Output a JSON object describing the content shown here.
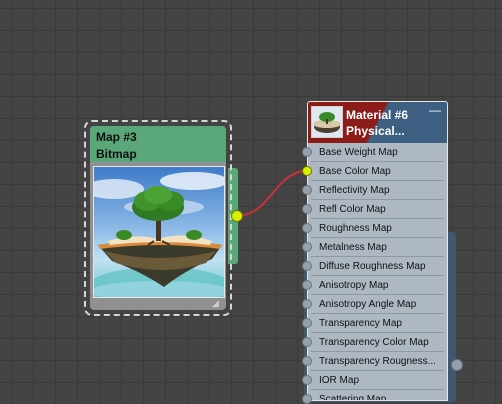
{
  "bitmap_node": {
    "title": "Map #3",
    "type": "Bitmap",
    "resize_glyph": "◢",
    "colors": {
      "header": "#5aa87a",
      "output_socket": "#d8f000"
    }
  },
  "material_node": {
    "title": "Material #6",
    "type": "Physical...",
    "collapse_glyph": "—",
    "colors": {
      "header_left": "#8b1c18",
      "header_right": "#3d5f82",
      "active_socket": "#d8f000"
    },
    "slots": [
      {
        "label": "Base Weight Map",
        "connected": false
      },
      {
        "label": "Base Color Map",
        "connected": true
      },
      {
        "label": "Reflectivity Map",
        "connected": false
      },
      {
        "label": "Refl Color Map",
        "connected": false
      },
      {
        "label": "Roughness Map",
        "connected": false
      },
      {
        "label": "Metalness Map",
        "connected": false
      },
      {
        "label": "Diffuse Roughness Map",
        "connected": false
      },
      {
        "label": "Anisotropy Map",
        "connected": false
      },
      {
        "label": "Anisotropy Angle Map",
        "connected": false
      },
      {
        "label": "Transparency Map",
        "connected": false
      },
      {
        "label": "Transparency Color Map",
        "connected": false
      },
      {
        "label": "Transparency Rougness...",
        "connected": false
      },
      {
        "label": "IOR Map",
        "connected": false
      },
      {
        "label": "Scattering Map",
        "connected": false
      }
    ]
  },
  "wire": {
    "from": "Map #3",
    "to": "Base Color Map",
    "color": "#c8323c"
  }
}
